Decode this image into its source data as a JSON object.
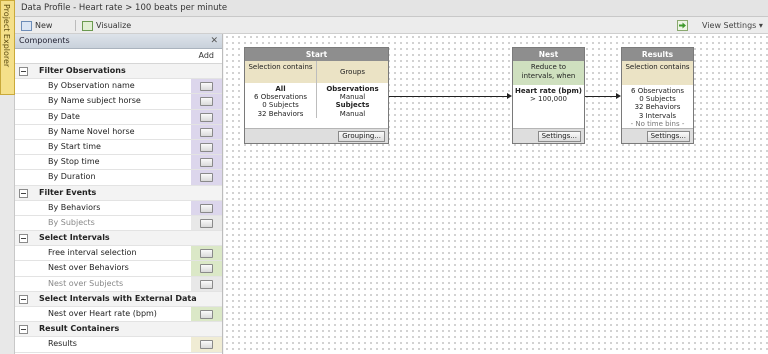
{
  "project_explorer": {
    "label": "Project Explorer"
  },
  "window": {
    "title": "Data Profile  - Heart rate > 100 beats per minute"
  },
  "toolbar": {
    "new_label": "New",
    "visualize_label": "Visualize",
    "view_settings_label": "View Settings",
    "view_settings_arrow": "▾"
  },
  "components": {
    "title": "Components",
    "close_glyph": "✕",
    "add_header": "Add",
    "rows": [
      {
        "kind": "cat",
        "label": "Filter Observations"
      },
      {
        "kind": "item",
        "label": "By Observation name",
        "style": "purple"
      },
      {
        "kind": "item",
        "label": "By Name subject horse",
        "style": "purple"
      },
      {
        "kind": "item",
        "label": "By Date",
        "style": "purple"
      },
      {
        "kind": "item",
        "label": "By Name Novel horse",
        "style": "purple"
      },
      {
        "kind": "item",
        "label": "By Start time",
        "style": "purple"
      },
      {
        "kind": "item",
        "label": "By Stop time",
        "style": "purple"
      },
      {
        "kind": "item",
        "label": "By Duration",
        "style": "purple"
      },
      {
        "kind": "cat",
        "label": "Filter Events"
      },
      {
        "kind": "item",
        "label": "By Behaviors",
        "style": "purple"
      },
      {
        "kind": "item",
        "label": "By Subjects",
        "style": "disabled"
      },
      {
        "kind": "cat",
        "label": "Select Intervals"
      },
      {
        "kind": "item",
        "label": "Free interval selection",
        "style": "green"
      },
      {
        "kind": "item",
        "label": "Nest over Behaviors",
        "style": "green"
      },
      {
        "kind": "item",
        "label": "Nest over Subjects",
        "style": "disabled"
      },
      {
        "kind": "cat",
        "label": "Select Intervals with External Data"
      },
      {
        "kind": "item",
        "label": "Nest over Heart rate (bpm)",
        "style": "green"
      },
      {
        "kind": "cat",
        "label": "Result Containers"
      },
      {
        "kind": "item",
        "label": "Results",
        "style": "yellow"
      }
    ]
  },
  "nodes": {
    "start": {
      "title": "Start",
      "col1_head": "Selection contains",
      "col1_body": [
        "All",
        "6 Observations",
        "0 Subjects",
        "32 Behaviors"
      ],
      "col2_head": "Groups",
      "col2_body": [
        "Observations",
        "Manual",
        "Subjects",
        "Manual"
      ],
      "button": "Grouping..."
    },
    "nest": {
      "title": "Nest",
      "head_lines": [
        "Reduce to",
        "intervals, when"
      ],
      "body": [
        "Heart rate (bpm)",
        "> 100,000"
      ],
      "button": "Settings..."
    },
    "results": {
      "title": "Results",
      "head": "Selection contains",
      "body": [
        "6 Observations",
        "0 Subjects",
        "32 Behaviors",
        "3 Intervals",
        "- No time bins -"
      ],
      "button": "Settings..."
    }
  }
}
